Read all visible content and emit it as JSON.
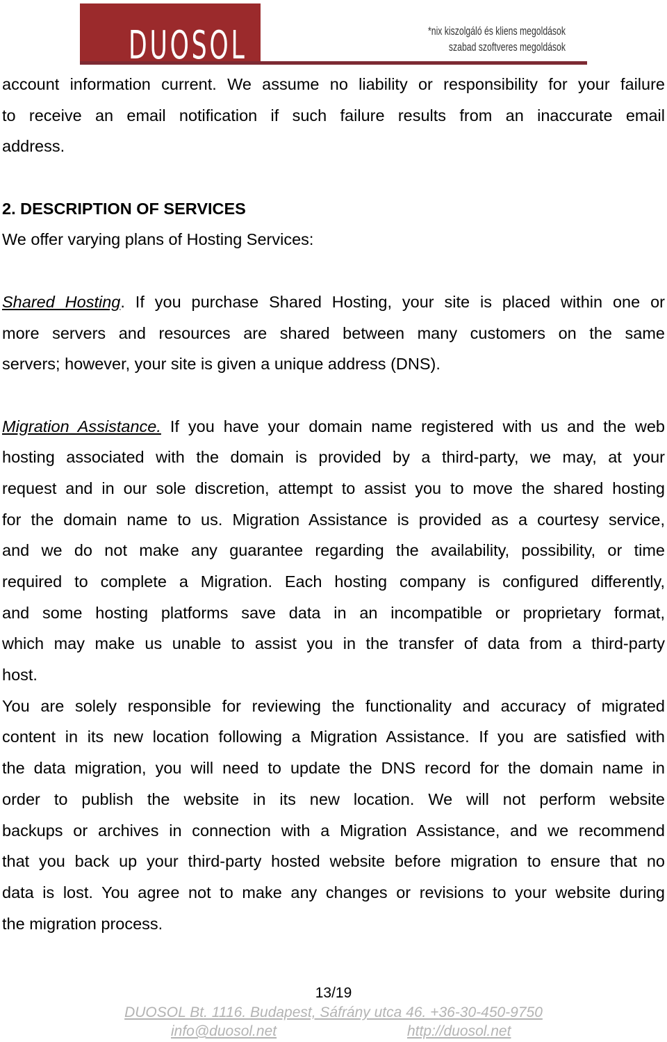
{
  "header": {
    "logo_text": "DUOSOL",
    "tagline_line1": "*nix kiszolgáló és kliens megoldások",
    "tagline_line2": "szabad szoftveres megoldások",
    "brand_color": "#9b2a2c",
    "rule_color": "#7d2a33"
  },
  "content": {
    "intro_lines": [
      "account information current. We assume no liability or responsibility for your failure",
      "to receive an email notification if such failure results from an inaccurate email",
      "address."
    ],
    "section_heading": "2. DESCRIPTION OF SERVICES",
    "section_intro": "We offer varying plans of Hosting Services:",
    "shared_hosting": {
      "term": "Shared Hosting",
      "lines": [
        ".  If you purchase Shared Hosting, your site is placed within one or",
        "more servers and resources are shared between many customers on the same",
        "servers; however, your site is given a unique address (DNS)."
      ]
    },
    "migration_assistance": {
      "term": "Migration Assistance.",
      "lines": [
        " If you have your domain name registered with us and the web",
        "hosting associated with the domain is provided by a third-party, we may, at your",
        "request and in our sole discretion, attempt to assist you to move the shared hosting",
        "for the domain name to us. Migration Assistance is provided as a courtesy service,",
        "and we do not make any guarantee regarding the availability, possibility, or time",
        "required to complete a Migration.  Each hosting company is configured differently,",
        "and some hosting platforms save data in an incompatible or proprietary format,",
        "which may make us unable to assist you in the transfer of data from a third-party",
        "host."
      ]
    },
    "responsibility_lines": [
      "You are solely responsible for reviewing the functionality and accuracy of migrated",
      "content in its new location following a Migration Assistance.  If you are satisfied with",
      "the data migration, you will need to update the DNS record for the domain name in",
      "order to publish the website in its new location.  We will not perform website",
      "backups or archives in connection with a Migration Assistance, and we recommend",
      "that you back up your third-party hosted website before migration to ensure that no",
      "data is lost.  You agree not to make any changes or revisions to your website during",
      "the migration process."
    ]
  },
  "footer": {
    "page_number": "13/19",
    "address": "DUOSOL Bt. 1116. Budapest, Sáfrány utca 46. +36-30-450-9750",
    "email": "info@duosol.net",
    "website": "http://duosol.net"
  }
}
